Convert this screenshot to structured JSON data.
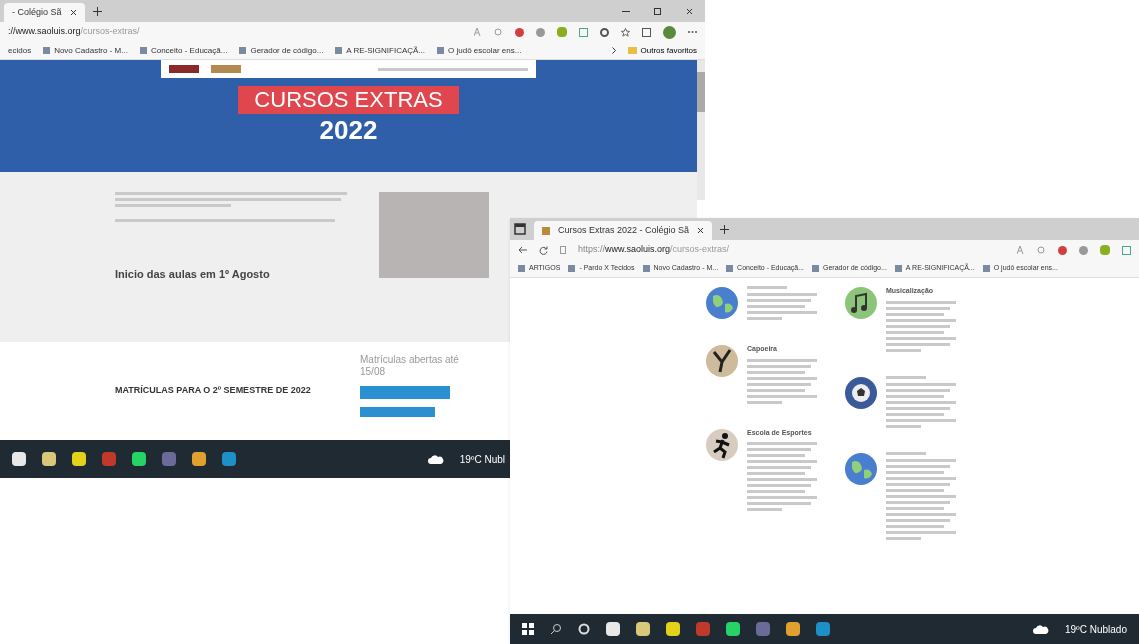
{
  "back_window": {
    "tab": {
      "title": "- Colégio Sã",
      "selected": true
    },
    "address": {
      "host": "://www.saoluis.org",
      "path": "/cursos-extras/"
    },
    "bookmarks": [
      "ecidos",
      "Novo Cadastro - M...",
      "Conceito - Educaçã...",
      "Gerador de código...",
      "A RE-SIGNIFICAÇÃ...",
      "O judô escolar ens..."
    ],
    "other_bookmarks": "Outros favoritos",
    "hero": {
      "title": "CURSOS EXTRAS",
      "year": "2022"
    },
    "start_heading": "Inicio das aulas em 1º Agosto",
    "enroll_heading": "MATRÍCULAS PARA O 2º SEMESTRE DE 2022",
    "enroll_note": "Matrículas abertas até 15/08",
    "weather": "19ºC Nubl"
  },
  "front_window": {
    "tab": {
      "title": "Cursos Extras 2022 - Colégio Sã",
      "selected": true
    },
    "address": {
      "scheme": "https://",
      "host": "www.saoluis.org",
      "path": "/cursos-extras/"
    },
    "bookmarks": [
      "ARTIGOS",
      "- Pardo X Tecidos",
      "Novo Cadastro - M...",
      "Conceito - Educaçã...",
      "Gerador de código...",
      "A RE-SIGNIFICAÇÃ...",
      "O judô escolar ens..."
    ],
    "courses": [
      [
        {
          "kind": "globe"
        },
        {
          "kind": "capoeira",
          "title": "Capoeira"
        },
        {
          "kind": "runner",
          "title": "Escola de Esportes"
        }
      ],
      [
        {
          "kind": "music",
          "title": "Musicalização"
        },
        {
          "kind": "ball"
        },
        {
          "kind": "globe"
        }
      ]
    ],
    "weather": "19ºC Nublado"
  }
}
